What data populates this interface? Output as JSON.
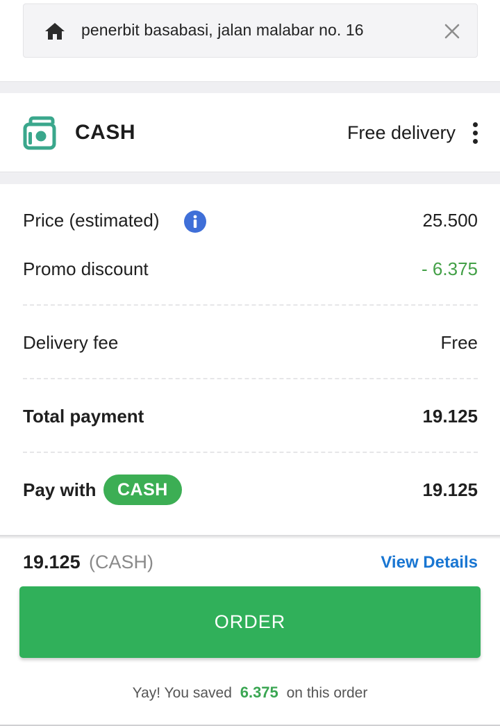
{
  "address": {
    "text": "penerbit basabasi, jalan malabar no. 16"
  },
  "payment_method": {
    "label": "CASH",
    "delivery": "Free delivery"
  },
  "details": {
    "price_label": "Price (estimated)",
    "price_value": "25.500",
    "promo_label": "Promo discount",
    "promo_value": "- 6.375",
    "delivery_fee_label": "Delivery fee",
    "delivery_fee_value": "Free",
    "total_label": "Total payment",
    "total_value": "19.125",
    "pay_with_label": "Pay with",
    "pay_with_method": "CASH",
    "pay_with_value": "19.125"
  },
  "summary": {
    "amount": "19.125",
    "method": "(CASH)",
    "view_details": "View Details"
  },
  "order_button": "ORDER",
  "savings": {
    "prefix": "Yay! You saved",
    "amount": "6.375",
    "suffix": "on this order"
  },
  "colors": {
    "primary_green": "#30b05a",
    "promo_green": "#43a047",
    "link_blue": "#1976d2",
    "info_blue": "#3f6fd8",
    "cash_icon_teal": "#3aa78c"
  },
  "icons": [
    "home-icon",
    "close-icon",
    "cash-icon",
    "more-vert-icon",
    "info-icon"
  ]
}
